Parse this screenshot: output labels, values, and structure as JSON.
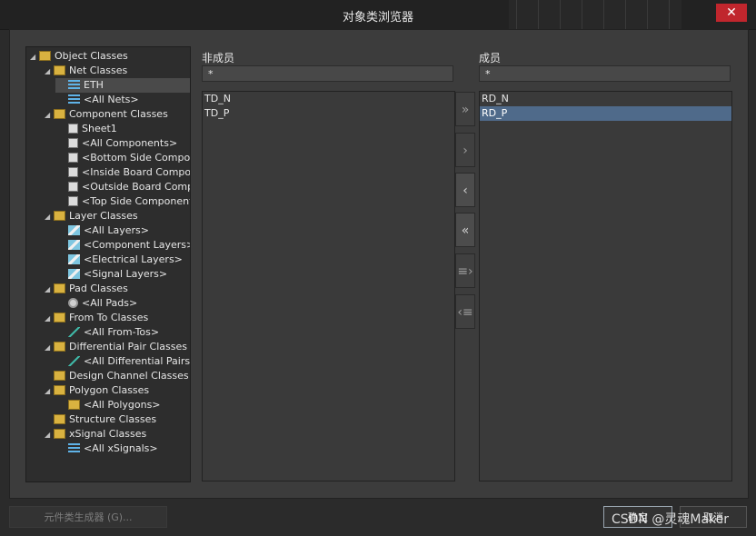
{
  "window": {
    "title": "对象类浏览器"
  },
  "tree": [
    {
      "label": "Object Classes",
      "depth": 0,
      "arrow": "◢",
      "icon": "folder-icon",
      "selected": false
    },
    {
      "label": "Net Classes",
      "depth": 1,
      "arrow": "◢",
      "icon": "folder-icon",
      "selected": false
    },
    {
      "label": "ETH",
      "depth": 2,
      "arrow": "",
      "icon": "net-icon",
      "selected": true
    },
    {
      "label": "<All Nets>",
      "depth": 2,
      "arrow": "",
      "icon": "net-icon",
      "selected": false
    },
    {
      "label": "Component Classes",
      "depth": 1,
      "arrow": "◢",
      "icon": "folder-icon",
      "selected": false
    },
    {
      "label": "Sheet1",
      "depth": 2,
      "arrow": "",
      "icon": "component-icon",
      "selected": false
    },
    {
      "label": "<All Components>",
      "depth": 2,
      "arrow": "",
      "icon": "component-icon",
      "selected": false
    },
    {
      "label": "<Bottom Side Compone",
      "depth": 2,
      "arrow": "",
      "icon": "component-icon",
      "selected": false
    },
    {
      "label": "<Inside Board Compo",
      "depth": 2,
      "arrow": "",
      "icon": "component-icon",
      "selected": false
    },
    {
      "label": "<Outside Board Comp",
      "depth": 2,
      "arrow": "",
      "icon": "component-icon",
      "selected": false
    },
    {
      "label": "<Top Side Component",
      "depth": 2,
      "arrow": "",
      "icon": "component-icon",
      "selected": false
    },
    {
      "label": "Layer Classes",
      "depth": 1,
      "arrow": "◢",
      "icon": "folder-icon",
      "selected": false
    },
    {
      "label": "<All Layers>",
      "depth": 2,
      "arrow": "",
      "icon": "layer-icon",
      "selected": false
    },
    {
      "label": "<Component Layers>",
      "depth": 2,
      "arrow": "",
      "icon": "layer-icon",
      "selected": false
    },
    {
      "label": "<Electrical Layers>",
      "depth": 2,
      "arrow": "",
      "icon": "layer-icon",
      "selected": false
    },
    {
      "label": "<Signal Layers>",
      "depth": 2,
      "arrow": "",
      "icon": "layer-icon",
      "selected": false
    },
    {
      "label": "Pad Classes",
      "depth": 1,
      "arrow": "◢",
      "icon": "folder-icon",
      "selected": false
    },
    {
      "label": "<All Pads>",
      "depth": 2,
      "arrow": "",
      "icon": "pad-icon",
      "selected": false
    },
    {
      "label": "From To Classes",
      "depth": 1,
      "arrow": "◢",
      "icon": "folder-icon",
      "selected": false
    },
    {
      "label": "<All From-Tos>",
      "depth": 2,
      "arrow": "",
      "icon": "from-to-icon",
      "selected": false
    },
    {
      "label": "Differential Pair Classes",
      "depth": 1,
      "arrow": "◢",
      "icon": "folder-icon",
      "selected": false
    },
    {
      "label": "<All Differential Pairs>",
      "depth": 2,
      "arrow": "",
      "icon": "from-to-icon",
      "selected": false
    },
    {
      "label": "Design Channel Classes",
      "depth": 1,
      "arrow": "",
      "icon": "folder-icon",
      "selected": false
    },
    {
      "label": "Polygon Classes",
      "depth": 1,
      "arrow": "◢",
      "icon": "folder-icon",
      "selected": false
    },
    {
      "label": "<All Polygons>",
      "depth": 2,
      "arrow": "",
      "icon": "polygon-icon",
      "selected": false
    },
    {
      "label": "Structure Classes",
      "depth": 1,
      "arrow": "",
      "icon": "folder-icon",
      "selected": false
    },
    {
      "label": "xSignal Classes",
      "depth": 1,
      "arrow": "◢",
      "icon": "folder-icon",
      "selected": false
    },
    {
      "label": "<All xSignals>",
      "depth": 2,
      "arrow": "",
      "icon": "net-icon",
      "selected": false
    }
  ],
  "non_members": {
    "heading": "非成员",
    "filter": "*",
    "items": [
      "TD_N",
      "TD_P"
    ]
  },
  "members": {
    "heading": "成员",
    "filter": "*",
    "items": [
      "RD_N",
      "RD_P"
    ],
    "selected_index": 1
  },
  "move_buttons": [
    {
      "glyph": "»",
      "name": "move-all-right-button",
      "dim": true
    },
    {
      "glyph": "›",
      "name": "move-right-button",
      "dim": true
    },
    {
      "glyph": "‹",
      "name": "move-left-button",
      "dim": false
    },
    {
      "glyph": "«",
      "name": "move-all-left-button",
      "dim": false
    },
    {
      "glyph": "≡›",
      "name": "move-class-right-button",
      "dim": true
    },
    {
      "glyph": "‹≡",
      "name": "move-class-left-button",
      "dim": true
    }
  ],
  "footer": {
    "generator": "元件类生成器 (G)...",
    "ok": "确定",
    "cancel": "取消",
    "watermark": "CSDN @灵魂Maker"
  },
  "colors": {
    "selection": "#4f6a8a",
    "close": "#c0262d",
    "folder": "#d9b240"
  }
}
